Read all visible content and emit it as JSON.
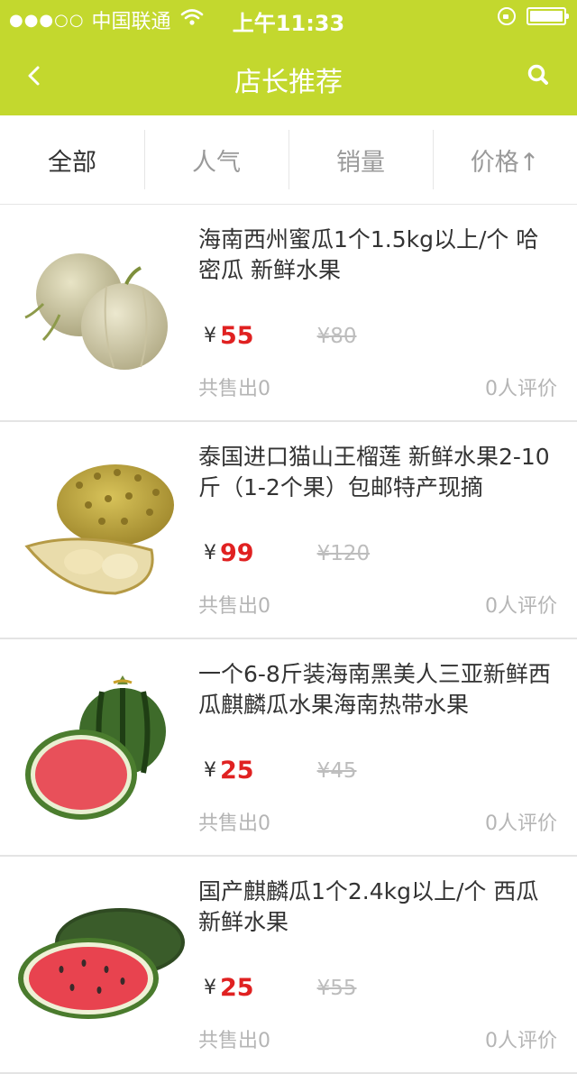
{
  "status": {
    "dots": "●●●○○",
    "carrier": "中国联通",
    "time": "上午11:33"
  },
  "nav": {
    "back_label": "<",
    "title": "店长推荐"
  },
  "tabs": [
    {
      "label": "全部",
      "active": true
    },
    {
      "label": "人气"
    },
    {
      "label": "销量"
    },
    {
      "label": "价格↑"
    }
  ],
  "colors": {
    "accent": "#c3d82e",
    "price": "#e02121"
  },
  "products": [
    {
      "name": " 海南西州蜜瓜1个1.5kg以上/个 哈密瓜 新鲜水果",
      "currency": "¥",
      "price": "55",
      "old_price": "¥80",
      "sold": "共售出0",
      "reviews": "0人评价",
      "image": "cantaloupe"
    },
    {
      "name": " 泰国进口猫山王榴莲 新鲜水果2-10斤（1-2个果）包邮特产现摘",
      "currency": "¥",
      "price": "99",
      "old_price": "¥120",
      "sold": "共售出0",
      "reviews": "0人评价",
      "image": "durian"
    },
    {
      "name": " 一个6-8斤装海南黑美人三亚新鲜西瓜麒麟瓜水果海南热带水果",
      "currency": "¥",
      "price": "25",
      "old_price": "¥45",
      "sold": "共售出0",
      "reviews": "0人评价",
      "image": "watermelon-round"
    },
    {
      "name": " 国产麒麟瓜1个2.4kg以上/个 西瓜新鲜水果",
      "currency": "¥",
      "price": "25",
      "old_price": "¥55",
      "sold": "共售出0",
      "reviews": "0人评价",
      "image": "watermelon-oval"
    }
  ]
}
